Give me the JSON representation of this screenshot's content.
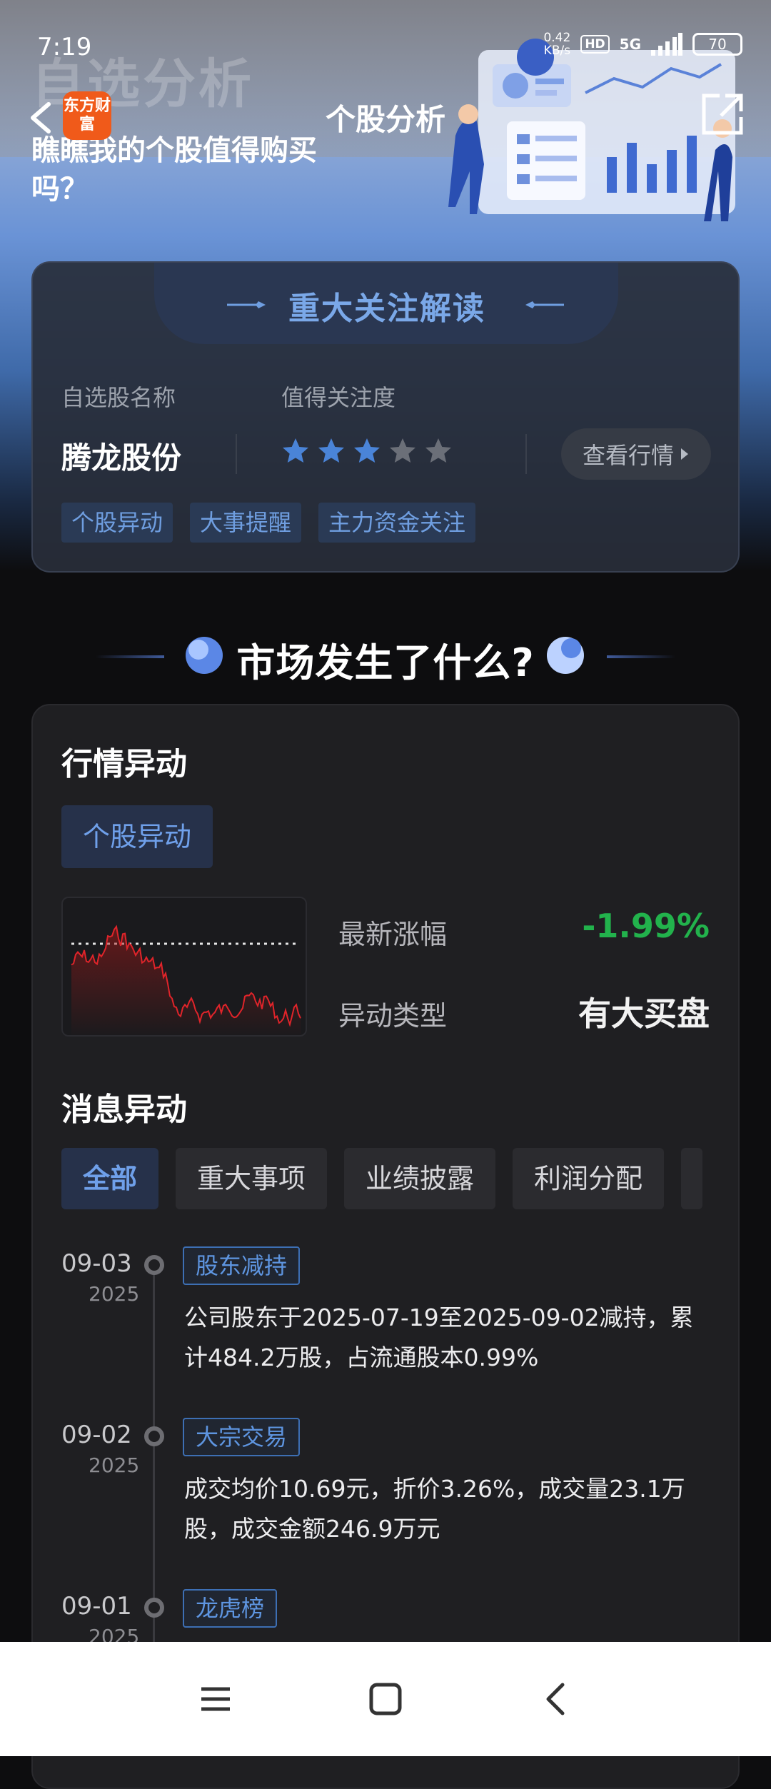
{
  "status_bar": {
    "time": "7:19",
    "net_rate": "0.42",
    "net_unit": "KB/s",
    "hd": "HD",
    "signal": "5G",
    "battery": "70"
  },
  "hero": {
    "bg_title": "自选分析",
    "subtitle": "瞧瞧我的个股值得购买吗？"
  },
  "nav": {
    "logo_text": "东方财富",
    "title": "个股分析"
  },
  "focus_card": {
    "title": "重大关注解读",
    "col_name_label": "自选股名称",
    "col_attention_label": "值得关注度",
    "stock_name": "腾龙股份",
    "rating": 3,
    "rating_max": 5,
    "market_button": "查看行情",
    "tags": [
      "个股异动",
      "大事提醒",
      "主力资金关注"
    ]
  },
  "section_title": "市场发生了什么?",
  "market_card": {
    "heading": "行情异动",
    "pill": "个股异动",
    "latest_change_label": "最新涨幅",
    "latest_change_value": "-1.99%",
    "anomaly_type_label": "异动类型",
    "anomaly_type_value": "有大买盘",
    "news_heading": "消息异动",
    "filters": [
      "全部",
      "重大事项",
      "业绩披露",
      "利润分配"
    ],
    "news": [
      {
        "date": "09-03",
        "year": "2025",
        "tag": "股东减持",
        "text": "公司股东于2025-07-19至2025-09-02减持，累计484.2万股，占流通股本0.99%"
      },
      {
        "date": "09-02",
        "year": "2025",
        "tag": "大宗交易",
        "text": "成交均价10.69元，折价3.26%，成交量23.1万股，成交金额246.9万元"
      },
      {
        "date": "09-01",
        "year": "2025",
        "tag": "龙虎榜",
        "text": ""
      }
    ]
  },
  "colors": {
    "accent_blue": "#6fa0ea",
    "down_green": "#22b24c",
    "star_on": "#4a84d8",
    "star_off": "#6b6f78"
  }
}
